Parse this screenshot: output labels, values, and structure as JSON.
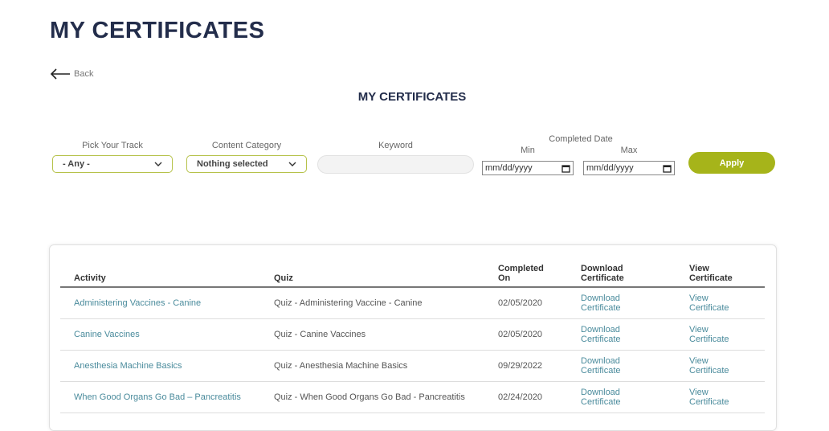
{
  "page_title": "MY CERTIFICATES",
  "back_label": "Back",
  "section_title": "MY CERTIFICATES",
  "filters": {
    "track_label": "Pick Your Track",
    "track_value": "- Any -",
    "category_label": "Content Category",
    "category_value": "Nothing selected",
    "keyword_label": "Keyword",
    "keyword_value": "",
    "date_label": "Completed Date",
    "min_label": "Min",
    "max_label": "Max",
    "min_placeholder": "mm/dd/yyyy",
    "max_placeholder": "mm/dd/yyyy",
    "apply_label": "Apply"
  },
  "table": {
    "headers": [
      "Activity",
      "Quiz",
      "Completed On",
      "Download Certificate",
      "View Certificate"
    ],
    "rows": [
      {
        "activity": "Administering Vaccines - Canine",
        "quiz": "Quiz - Administering Vaccine - Canine",
        "date": "02/05/2020",
        "download": "Download Certificate",
        "view": "View Certificate"
      },
      {
        "activity": "Canine Vaccines",
        "quiz": "Quiz - Canine Vaccines",
        "date": "02/05/2020",
        "download": "Download Certificate",
        "view": "View Certificate"
      },
      {
        "activity": "Anesthesia Machine Basics",
        "quiz": "Quiz - Anesthesia Machine Basics",
        "date": "09/29/2022",
        "download": "Download Certificate",
        "view": "View Certificate"
      },
      {
        "activity": "When Good Organs Go Bad – Pancreatitis",
        "quiz": "Quiz - When Good Organs Go Bad - Pancreatitis",
        "date": "02/24/2020",
        "download": "Download Certificate",
        "view": "View Certificate"
      }
    ]
  },
  "colors": {
    "title": "#232d4b",
    "accent": "#a6b41a",
    "link": "#4a8b9c"
  }
}
